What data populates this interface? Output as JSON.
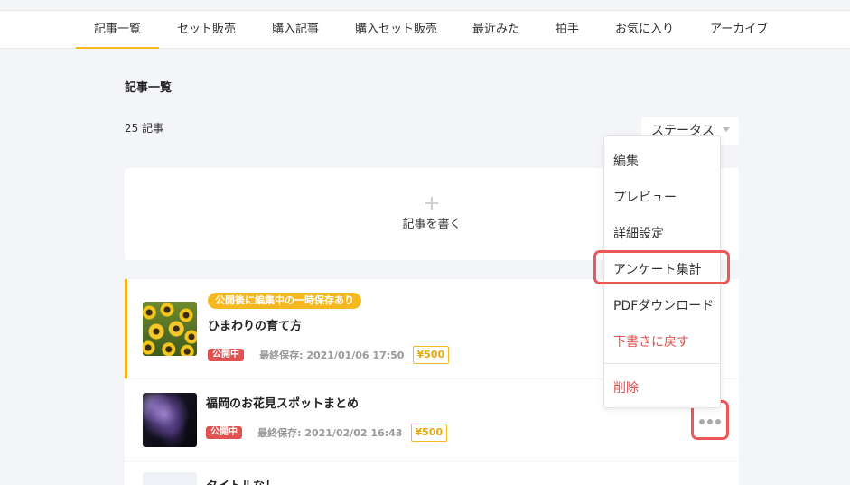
{
  "tabs": [
    "記事一覧",
    "セット販売",
    "購入記事",
    "購入セット販売",
    "最近みた",
    "拍手",
    "お気に入り",
    "アーカイブ"
  ],
  "page_title": "記事一覧",
  "count_label": "25 記事",
  "status_select": {
    "value": "ステータス",
    "icon": "chevron-down-icon"
  },
  "new_article": {
    "icon": "plus-icon",
    "label": "記事を書く"
  },
  "articles": [
    {
      "badge": "公開後に編集中の一時保存あり",
      "title": "ひまわりの育て方",
      "status": "公開中",
      "saved": "最終保存: 2021/01/06 17:50",
      "price": "¥500",
      "accent": "#f5b820"
    },
    {
      "title": "福岡のお花見スポットまとめ",
      "status": "公開中",
      "saved": "最終保存: 2021/02/02 16:43",
      "price": "¥500"
    },
    {
      "title": "タイトルなし"
    }
  ],
  "menu": {
    "items": [
      "編集",
      "プレビュー",
      "詳細設定",
      "アンケート集計",
      "PDFダウンロード",
      "下書きに戻す",
      "削除"
    ],
    "danger_color": "#e05151"
  },
  "more_button_icon": "more-dots-icon",
  "colors": {
    "accent": "#f5b820",
    "danger": "#e05151",
    "highlight": "#ee5757"
  }
}
